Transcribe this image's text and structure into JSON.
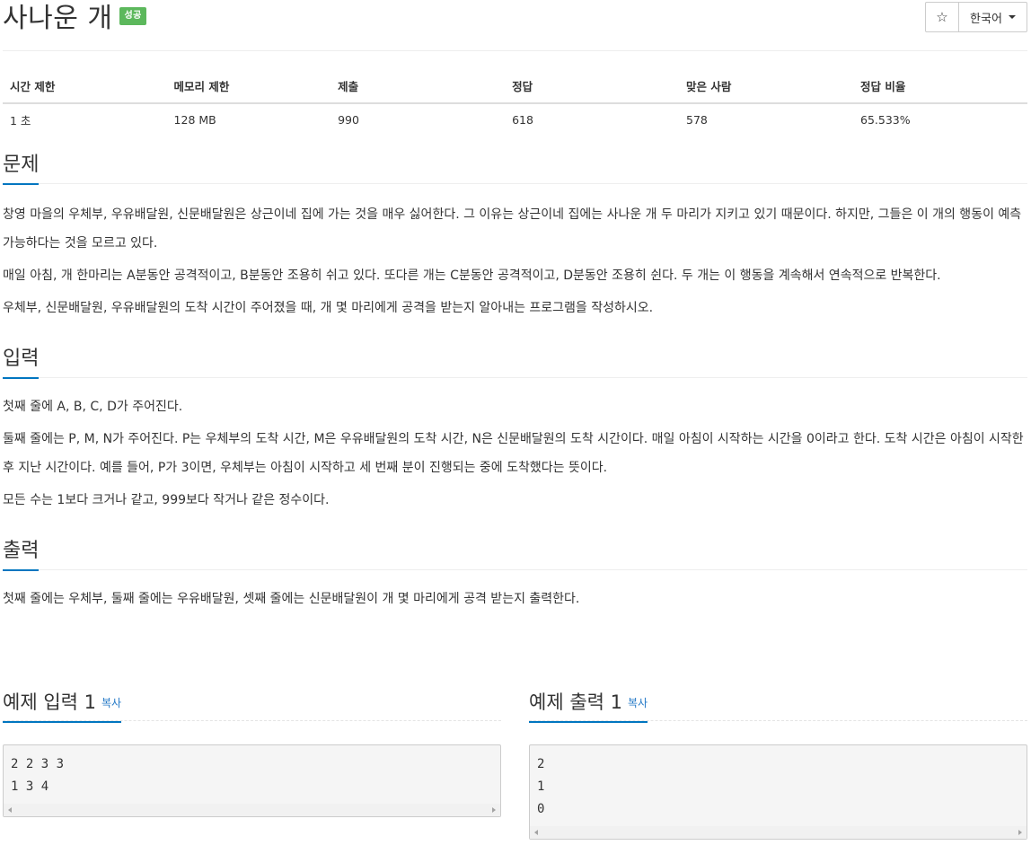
{
  "problem": {
    "title": "사나운 개",
    "badge": "성공"
  },
  "toolbar": {
    "star_icon": "☆",
    "language": "한국어"
  },
  "info_table": {
    "headers": [
      "시간 제한",
      "메모리 제한",
      "제출",
      "정답",
      "맞은 사람",
      "정답 비율"
    ],
    "values": [
      "1 초",
      "128 MB",
      "990",
      "618",
      "578",
      "65.533%"
    ]
  },
  "sections": {
    "description": {
      "title": "문제",
      "paragraphs": [
        "창영 마을의 우체부, 우유배달원, 신문배달원은 상근이네 집에 가는 것을 매우 싫어한다. 그 이유는 상근이네 집에는 사나운 개 두 마리가 지키고 있기 때문이다. 하지만, 그들은 이 개의 행동이 예측 가능하다는 것을 모르고 있다.",
        "매일 아침, 개 한마리는 A분동안 공격적이고, B분동안 조용히 쉬고 있다. 또다른 개는 C분동안 공격적이고, D분동안 조용히 쉰다. 두 개는 이 행동을 계속해서 연속적으로 반복한다.",
        "우체부, 신문배달원, 우유배달원의 도착 시간이 주어졌을 때, 개 몇 마리에게 공격을 받는지 알아내는 프로그램을 작성하시오."
      ]
    },
    "input": {
      "title": "입력",
      "paragraphs": [
        "첫째 줄에 A, B, C, D가 주어진다.",
        "둘째 줄에는 P, M, N가 주어진다. P는 우체부의 도착 시간, M은 우유배달원의 도착 시간, N은 신문배달원의 도착 시간이다. 매일 아침이 시작하는 시간을 0이라고 한다. 도착 시간은 아침이 시작한 후 지난 시간이다. 예를 들어, P가 3이면, 우체부는 아침이 시작하고 세 번째 분이 진행되는 중에 도착했다는 뜻이다.",
        "모든 수는 1보다 크거나 같고, 999보다 작거나 같은 정수이다."
      ]
    },
    "output": {
      "title": "출력",
      "paragraphs": [
        "첫째 줄에는 우체부, 둘째 줄에는 우유배달원, 셋째 줄에는 신문배달원이 개 몇 마리에게 공격 받는지 출력한다."
      ]
    }
  },
  "samples": {
    "input": {
      "title": "예제 입력 1",
      "copy_label": "복사",
      "content": "2 2 3 3\n1 3 4"
    },
    "output": {
      "title": "예제 출력 1",
      "copy_label": "복사",
      "content": "2\n1\n0"
    }
  }
}
